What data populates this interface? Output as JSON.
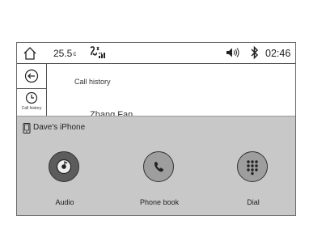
{
  "status_bar": {
    "temperature": "25.5",
    "temperature_unit": "c",
    "time": "02:46",
    "icons": [
      "home-icon",
      "fan-icon",
      "signal-icon",
      "volume-icon",
      "bluetooth-icon"
    ]
  },
  "sidebar": {
    "back_icon": "back-arrow-icon",
    "call_history_label": "Call history"
  },
  "page": {
    "title": "Call history",
    "partial_contact": "Zhang Fan"
  },
  "phone_panel": {
    "device_name": "Dave's iPhone",
    "tiles": [
      {
        "label": "Audio",
        "icon": "audio-icon"
      },
      {
        "label": "Phone book",
        "icon": "phonebook-icon"
      },
      {
        "label": "Dial",
        "icon": "dial-keypad-icon"
      }
    ]
  },
  "colors": {
    "panel": "#c8c8c8",
    "audio_tile": "#5c5c5c",
    "tile": "#9e9e9e"
  }
}
